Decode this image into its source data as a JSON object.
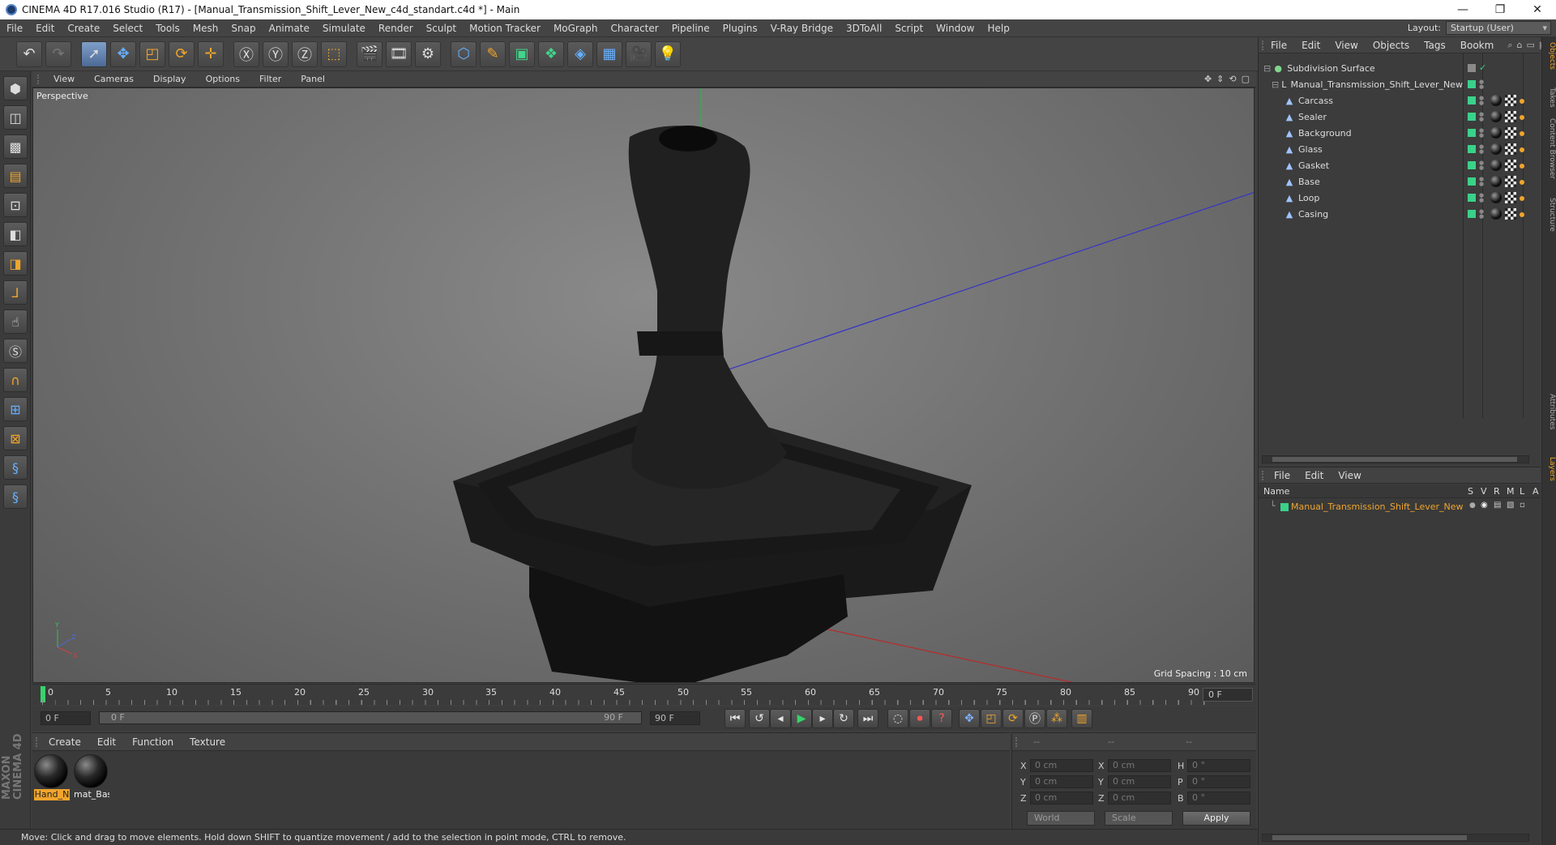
{
  "window": {
    "title": "CINEMA 4D R17.016 Studio (R17) - [Manual_Transmission_Shift_Lever_New_c4d_standart.c4d *] - Main"
  },
  "menu": [
    "File",
    "Edit",
    "Create",
    "Select",
    "Tools",
    "Mesh",
    "Snap",
    "Animate",
    "Simulate",
    "Render",
    "Sculpt",
    "Motion Tracker",
    "MoGraph",
    "Character",
    "Pipeline",
    "Plugins",
    "V-Ray Bridge",
    "3DToAll",
    "Script",
    "Window",
    "Help"
  ],
  "layout": {
    "label": "Layout:",
    "value": "Startup (User)"
  },
  "viewport": {
    "menu": [
      "View",
      "Cameras",
      "Display",
      "Options",
      "Filter",
      "Panel"
    ],
    "label": "Perspective",
    "grid_spacing": "Grid Spacing : 10 cm"
  },
  "timeline": {
    "ticks": [
      "0",
      "5",
      "10",
      "15",
      "20",
      "25",
      "30",
      "35",
      "40",
      "45",
      "50",
      "55",
      "60",
      "65",
      "70",
      "75",
      "80",
      "85",
      "90"
    ],
    "end_frame_display": "0 F",
    "current_frame": "0 F",
    "range_start": "0 F",
    "range_end": "90 F",
    "max_frame": "90 F"
  },
  "material_manager": {
    "menu": [
      "Create",
      "Edit",
      "Function",
      "Texture"
    ],
    "materials": [
      {
        "name": "Hand_N",
        "selected": true
      },
      {
        "name": "mat_Bas",
        "selected": false
      }
    ]
  },
  "coordinates": {
    "header": [
      "--",
      "--",
      "--"
    ],
    "rows": [
      {
        "l1": "X",
        "v1": "0 cm",
        "l2": "X",
        "v2": "0 cm",
        "l3": "H",
        "v3": "0 °"
      },
      {
        "l1": "Y",
        "v1": "0 cm",
        "l2": "Y",
        "v2": "0 cm",
        "l3": "P",
        "v3": "0 °"
      },
      {
        "l1": "Z",
        "v1": "0 cm",
        "l2": "Z",
        "v2": "0 cm",
        "l3": "B",
        "v3": "0 °"
      }
    ],
    "mode": "World",
    "type": "Scale",
    "apply": "Apply"
  },
  "status_text": "Move: Click and drag to move elements. Hold down SHIFT to quantize movement / add to the selection in point mode, CTRL to remove.",
  "object_manager": {
    "menu": [
      "File",
      "Edit",
      "View",
      "Objects",
      "Tags",
      "Bookm"
    ],
    "objects": [
      {
        "name": "Subdivision Surface",
        "level": 0,
        "kind": "parent"
      },
      {
        "name": "Manual_Transmission_Shift_Lever_New",
        "level": 1,
        "kind": "null"
      },
      {
        "name": "Carcass",
        "level": 2,
        "kind": "child"
      },
      {
        "name": "Sealer",
        "level": 2,
        "kind": "child"
      },
      {
        "name": "Background",
        "level": 2,
        "kind": "child"
      },
      {
        "name": "Glass",
        "level": 2,
        "kind": "child"
      },
      {
        "name": "Gasket",
        "level": 2,
        "kind": "child"
      },
      {
        "name": "Base",
        "level": 2,
        "kind": "child"
      },
      {
        "name": "Loop",
        "level": 2,
        "kind": "child"
      },
      {
        "name": "Casing",
        "level": 2,
        "kind": "child"
      }
    ]
  },
  "layer_manager": {
    "menu": [
      "File",
      "Edit",
      "View"
    ],
    "columns": [
      "Name",
      "S",
      "V",
      "R",
      "M",
      "L",
      "A"
    ],
    "layer_name": "Manual_Transmission_Shift_Lever_New"
  },
  "side_tabs": [
    "Objects",
    "Takes",
    "Content Browser",
    "Structure",
    "Attributes",
    "Layers"
  ],
  "colors": {
    "accent_orange": "#f0a52c",
    "layer_green": "#3ad18a",
    "axis_x": "#c0392b",
    "axis_y": "#2ecc71",
    "axis_z": "#3a3ad0"
  }
}
